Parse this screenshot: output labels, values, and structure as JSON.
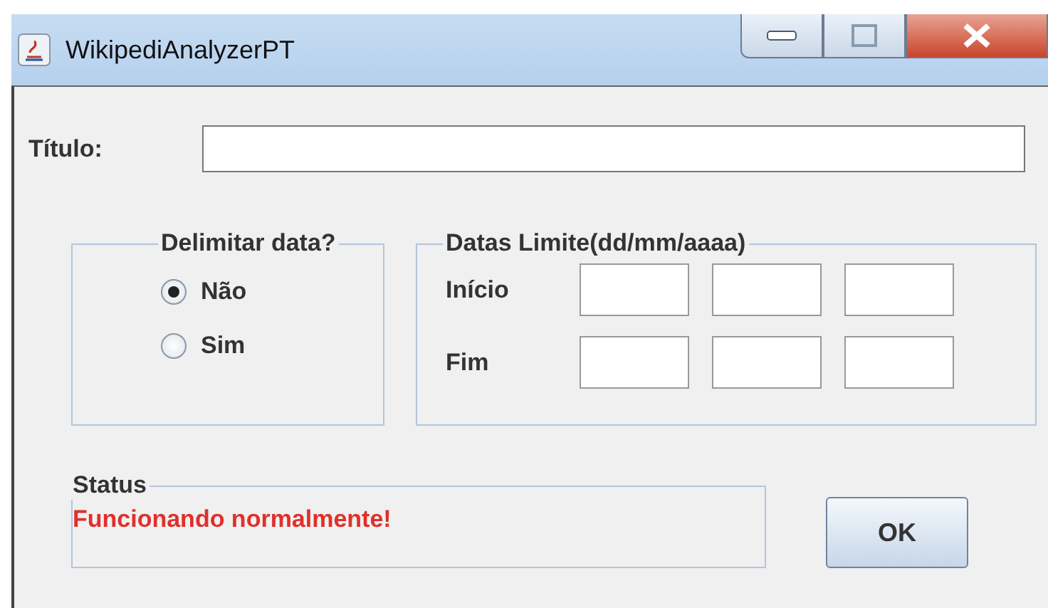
{
  "window": {
    "title": "WikipediAnalyzerPT"
  },
  "title_label": "Título:",
  "date_filter": {
    "legend": "Delimitar data?",
    "options": [
      {
        "label": "Não",
        "selected": true
      },
      {
        "label": "Sim",
        "selected": false
      }
    ]
  },
  "date_limits": {
    "legend": "Datas Limite(dd/mm/aaaa)",
    "rows": [
      {
        "label": "Início"
      },
      {
        "label": "Fim"
      }
    ]
  },
  "status": {
    "legend": "Status",
    "message": "Funcionando normalmente!"
  },
  "ok_button": "OK"
}
